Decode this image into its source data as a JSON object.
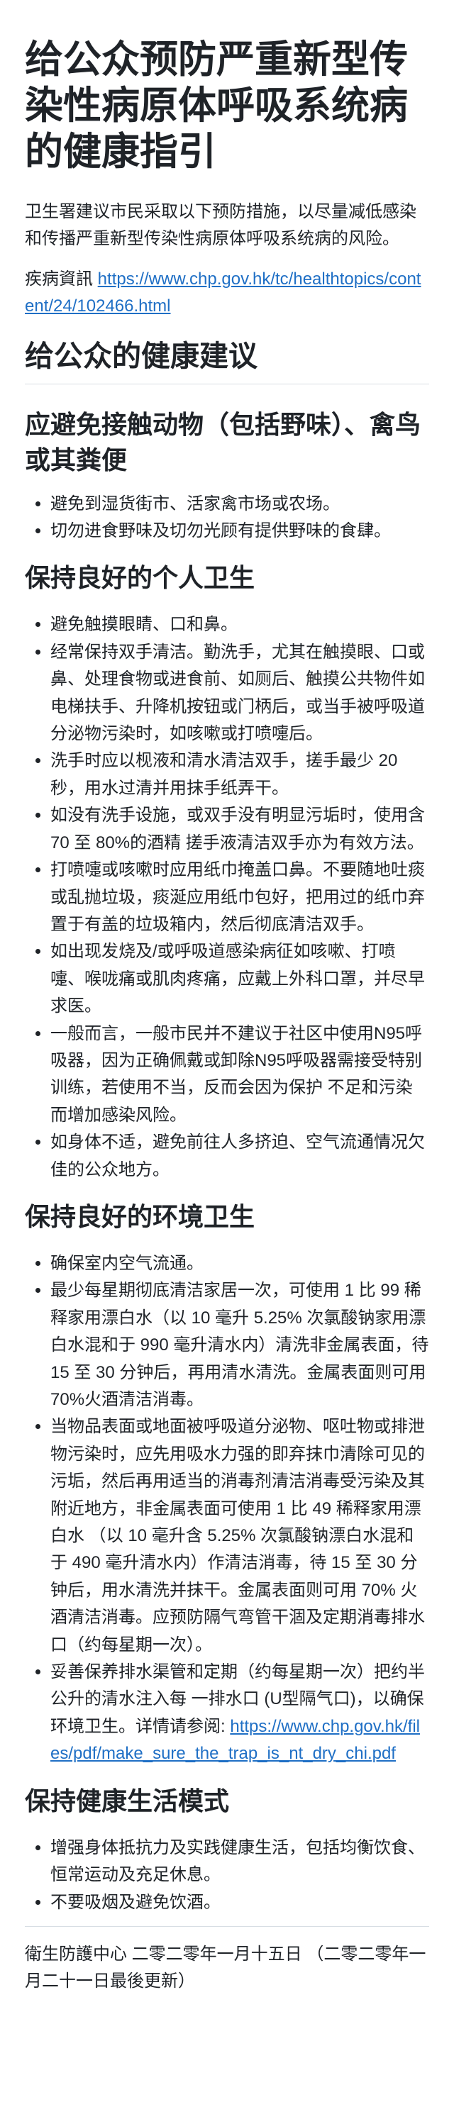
{
  "document": {
    "title": "给公众预防严重新型传染性病原体呼吸系统病的健康指引",
    "intro": "卫生署建议市民采取以下预防措施，以尽量减低感染和传播严重新型传染性病原体呼吸系统病的风险。",
    "info": {
      "label": "疾病資訊",
      "url": "https://www.chp.gov.hk/tc/healthtopics/content/24/102466.html"
    }
  },
  "advice": {
    "heading": "给公众的健康建议",
    "sections": [
      {
        "heading": "应避免接触动物（包括野味）、禽鸟或其粪便",
        "items": [
          "避免到湿货街市、活家禽市场或农场。",
          "切勿进食野味及切勿光顾有提供野味的食肆。"
        ]
      },
      {
        "heading": "保持良好的个人卫生",
        "items": [
          "避免触摸眼睛、口和鼻。",
          "经常保持双手清洁。勤洗手，尤其在触摸眼、口或鼻、处理食物或进食前、如厕后、触摸公共物件如电梯扶手、升降机按钮或门柄后，或当手被呼吸道分泌物污染时，如咳嗽或打喷嚏后。",
          "洗手时应以枧液和清水清洁双手，搓手最少 20 秒，用水过清并用抹手纸弄干。",
          "如没有洗手设施，或双手没有明显污垢时，使用含 70 至 80%的酒精 搓手液清洁双手亦为有效方法。",
          "打喷嚏或咳嗽时应用纸巾掩盖口鼻。不要随地吐痰或乱抛垃圾，痰涎应用纸巾包好，把用过的纸巾弃置于有盖的垃圾箱内，然后彻底清洁双手。",
          "如出现发烧及/或呼吸道感染病征如咳嗽、打喷嚏、喉咙痛或肌肉疼痛，应戴上外科口罩，并尽早求医。",
          "一般而言，一般市民并不建议于社区中使用N95呼吸器，因为正确佩戴或卸除N95呼吸器需接受特别训练，若使用不当，反而会因为保护 不足和污染而增加感染风险。",
          "如身体不适，避免前往人多挤迫、空气流通情况欠佳的公众地方。"
        ]
      },
      {
        "heading": "保持良好的环境卫生",
        "items": [
          "确保室内空气流通。",
          "最少每星期彻底清洁家居一次，可使用 1 比 99 稀释家用漂白水（以 10 毫升 5.25% 次氯酸钠家用漂白水混和于 990 毫升清水内）清洗非金属表面，待 15 至 30 分钟后，再用清水清洗。金属表面则可用 70%火酒清洁消毒。",
          "当物品表面或地面被呼吸道分泌物、呕吐物或排泄物污染时，应先用吸水力强的即弃抹巾清除可见的污垢，然后再用适当的消毒剂清洁消毒受污染及其附近地方，非金属表面可使用 1 比 49 稀释家用漂白水 （以 10 毫升含 5.25% 次氯酸钠漂白水混和于 490 毫升清水内）作清洁消毒，待 15 至 30 分钟后，用水清洗并抹干。金属表面则可用 70% 火酒清洁消毒。应预防隔气弯管干涸及定期消毒排水口（约每星期一次）。",
          {
            "text": "妥善保养排水渠管和定期（约每星期一次）把约半公升的清水注入每 一排水口 (U型隔气口)，以确保环境卫生。详情请参阅: ",
            "link": "https://www.chp.gov.hk/files/pdf/make_sure_the_trap_is_nt_dry_chi.pdf"
          }
        ]
      },
      {
        "heading": "保持健康生活模式",
        "items": [
          "增强身体抵抗力及实践健康生活，包括均衡饮食、恒常运动及充足休息。",
          "不要吸烟及避免饮酒。"
        ]
      }
    ]
  },
  "footer": {
    "text": "衛生防護中心 二零二零年一月十五日 （二零二零年一月二十一日最後更新）"
  },
  "colors": {
    "background": "#ffffff",
    "text": "#1f2328",
    "link": "#1f6fc5",
    "rule": "#d8dee4"
  }
}
